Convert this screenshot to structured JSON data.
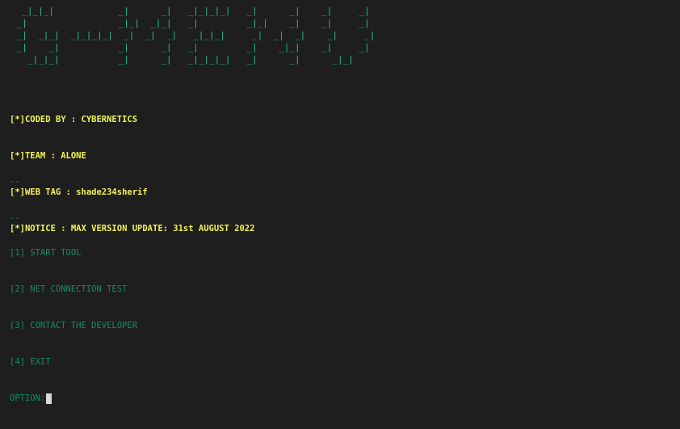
{
  "banner": {
    "ascii": "  _|_|_|            _|      _|   _|_|_|_|   _|      _|    _|     _|\n _|                 _|_|  _|_|   _|         _|_|    _|    _|     _|\n _|  _|_|  _|_|_|_|  _|  _|  _|   _|_|_|     _|  _|  _|    _|     _|\n _|    _|           _|      _|   _|         _|    _|_|    _|     _|\n   _|_|_|           _|      _|   _|_|_|_|   _|      _|      _|_|"
  },
  "info": {
    "coded_by": "[*]CODED BY : CYBERNETICS",
    "team": "[*]TEAM : ALONE",
    "web_tag": "[*]WEB TAG : shade234sherif",
    "notice": "[*]NOTICE : MAX VERSION UPDATE: 31st AUGUST 2022"
  },
  "menu": {
    "separator_1": "..",
    "separator_2": "..",
    "items": [
      "[1] START TOOL",
      "[2] NET CONNECTION TEST",
      "[3] CONTACT THE DEVELOPER",
      "[4] EXIT"
    ],
    "prompt": "OPTION:"
  },
  "colors": {
    "background": "#1e1e1e",
    "banner": "#22c08a",
    "info": "#f2f25a",
    "menu": "#1a8a66",
    "cursor": "#d8d8d8"
  }
}
